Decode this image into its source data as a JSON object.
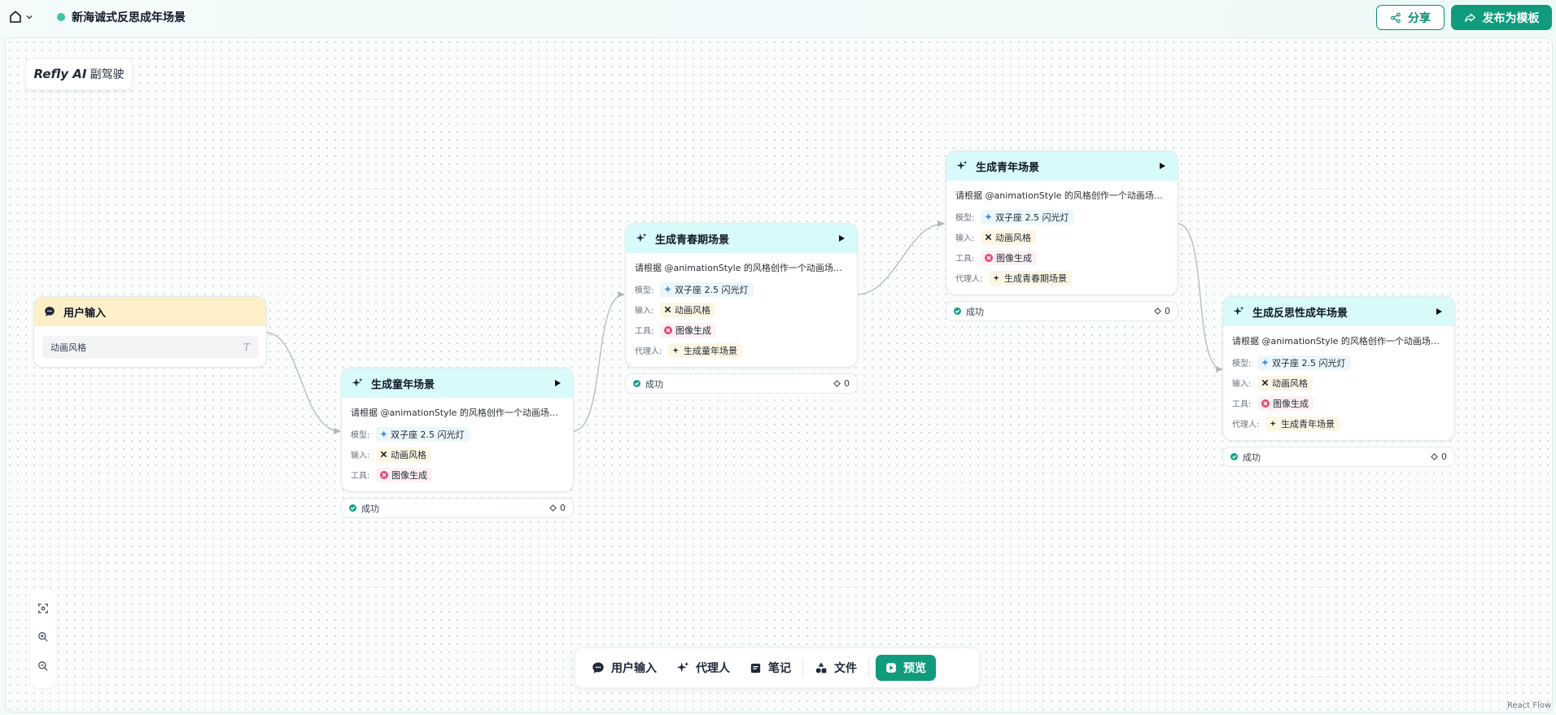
{
  "header": {
    "title": "新海诚式反思成年场景",
    "share_label": "分享",
    "publish_label": "发布为模板"
  },
  "copilot": {
    "brand": "Refly AI",
    "suffix": "副驾驶"
  },
  "labels": {
    "model": "模型:",
    "input": "输入:",
    "tool": "工具:",
    "agent": "代理人:",
    "status_success": "成功",
    "count": "0"
  },
  "nodes": {
    "user_input": {
      "title": "用户输入",
      "field_value": "动画风格",
      "field_type": "T"
    },
    "childhood": {
      "title": "生成童年场景",
      "prompt": "请根据 @animationStyle 的风格创作一个动画场景。描述童年记忆的场景…",
      "model": "双子座 2.5 闪光灯",
      "input": "动画风格",
      "tool": "图像生成"
    },
    "youth": {
      "title": "生成青春期场景",
      "prompt": "请根据 @animationStyle 的风格创作一个动画场景。描述青春期的场景…",
      "model": "双子座 2.5 闪光灯",
      "input": "动画风格",
      "tool": "图像生成",
      "agent": "生成童年场景"
    },
    "young_adult": {
      "title": "生成青年场景",
      "prompt": "请根据 @animationStyle 的风格创作一个动画场景。描述青年时期的场景…",
      "model": "双子座 2.5 闪光灯",
      "input": "动画风格",
      "tool": "图像生成",
      "agent": "生成青春期场景"
    },
    "reflection": {
      "title": "生成反思性成年场景",
      "prompt": "请根据 @animationStyle 的风格创作一个动画场景。描述反思性成年的场景…",
      "model": "双子座 2.5 闪光灯",
      "input": "动画风格",
      "tool": "图像生成",
      "agent": "生成青年场景"
    }
  },
  "toolbar": {
    "user_input": "用户输入",
    "agent": "代理人",
    "note": "笔记",
    "file": "文件",
    "preview": "预览"
  },
  "attribution": "React Flow",
  "colors": {
    "accent": "#0f9b7c",
    "node_header_cyan": "#d8fafa",
    "node_header_yellow": "#fdf0c8"
  }
}
